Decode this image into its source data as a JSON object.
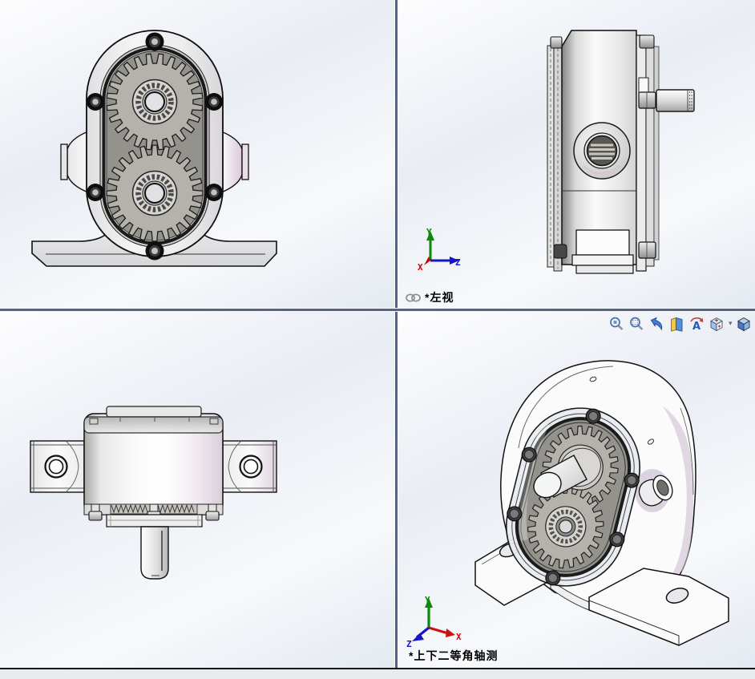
{
  "viewport_labels": {
    "top_right": "*左视",
    "bottom_right": "*上下二等角轴测"
  },
  "viewports": [
    {
      "id": "front-view",
      "label": ""
    },
    {
      "id": "left-view",
      "label": "*左视",
      "linked": true
    },
    {
      "id": "top-view",
      "label": ""
    },
    {
      "id": "isometric-view",
      "label": "*上下二等角轴测",
      "linked": false
    }
  ],
  "triad": {
    "x": "X",
    "y": "Y",
    "z": "Z",
    "x_color": "#dd0000",
    "y_color": "#0a8a0a",
    "z_color": "#1515cc"
  },
  "view_toolbar": {
    "dropdown_caret": "▾",
    "icons": [
      {
        "name": "zoom-to-fit-icon"
      },
      {
        "name": "zoom-to-area-icon"
      },
      {
        "name": "previous-view-icon"
      },
      {
        "name": "section-view-icon"
      },
      {
        "name": "rotate-view-icon"
      },
      {
        "name": "view-orientation-icon",
        "has_dropdown": true
      },
      {
        "name": "display-style-icon",
        "has_dropdown": true
      }
    ]
  },
  "colors": {
    "viewport_divider": "#55628a",
    "background_light": "#fdfdfe",
    "background_shade": "#e4e9f1",
    "housing_gray": "#e6e6e6",
    "chamber_gray": "#94928c",
    "gear_gray": "#b5b2ac",
    "side_face_pink": "#cfc0d1",
    "statusbar": "#e8eaee"
  }
}
